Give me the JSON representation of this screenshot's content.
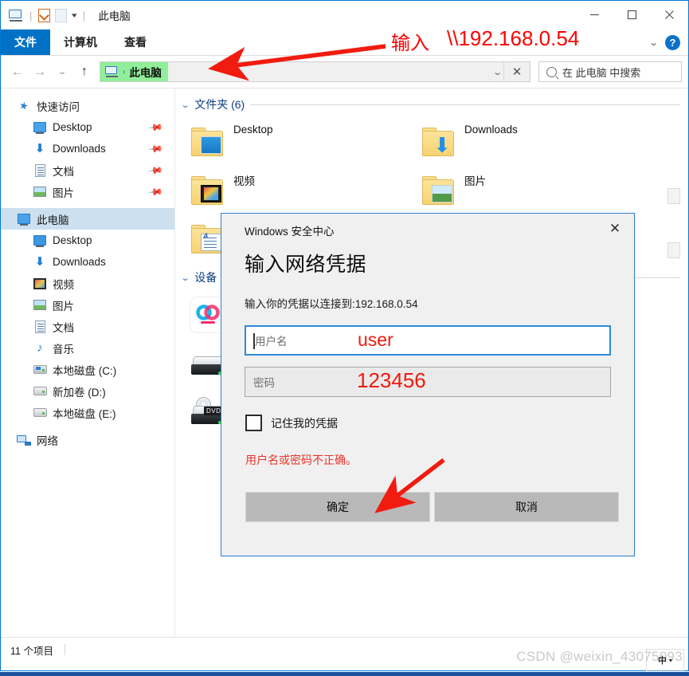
{
  "window": {
    "title": "此电脑",
    "quick_access_icons": [
      "this-pc-icon",
      "properties-icon",
      "new-folder-icon",
      "customize-caret-icon"
    ],
    "controls": {
      "minimize": "—",
      "maximize": "□",
      "close": "✕"
    }
  },
  "ribbon": {
    "tabs": [
      {
        "label": "文件",
        "active": true
      },
      {
        "label": "计算机",
        "active": false
      },
      {
        "label": "查看",
        "active": false
      }
    ],
    "collapse_caret": "⌄",
    "help_label": "?"
  },
  "addressbar": {
    "back": "←",
    "forward": "→",
    "recent": "⌄",
    "up": "↑",
    "breadcrumb_icon": "this-pc-icon",
    "breadcrumb_sep": "›",
    "breadcrumb_text": "此电脑",
    "dropdown_caret": "⌄",
    "clear_label": "✕",
    "search_placeholder": "在 此电脑 中搜索"
  },
  "sidebar": {
    "items": [
      {
        "label": "快速访问",
        "icon": "star-icon",
        "level": 0,
        "pinned": false,
        "selected": false
      },
      {
        "label": "Desktop",
        "icon": "monitor-icon",
        "level": 1,
        "pinned": true,
        "selected": false
      },
      {
        "label": "Downloads",
        "icon": "download-icon",
        "level": 1,
        "pinned": true,
        "selected": false
      },
      {
        "label": "文档",
        "icon": "documents-icon",
        "level": 1,
        "pinned": true,
        "selected": false
      },
      {
        "label": "图片",
        "icon": "pictures-icon",
        "level": 1,
        "pinned": true,
        "selected": false
      },
      {
        "label": "此电脑",
        "icon": "this-pc-icon",
        "level": 0,
        "pinned": false,
        "selected": true
      },
      {
        "label": "Desktop",
        "icon": "monitor-icon",
        "level": 1,
        "pinned": false,
        "selected": false
      },
      {
        "label": "Downloads",
        "icon": "download-icon",
        "level": 1,
        "pinned": false,
        "selected": false
      },
      {
        "label": "视频",
        "icon": "videos-icon",
        "level": 1,
        "pinned": false,
        "selected": false
      },
      {
        "label": "图片",
        "icon": "pictures-icon",
        "level": 1,
        "pinned": false,
        "selected": false
      },
      {
        "label": "文档",
        "icon": "documents-icon",
        "level": 1,
        "pinned": false,
        "selected": false
      },
      {
        "label": "音乐",
        "icon": "music-icon",
        "level": 1,
        "pinned": false,
        "selected": false
      },
      {
        "label": "本地磁盘 (C:)",
        "icon": "system-drive-icon",
        "level": 1,
        "pinned": false,
        "selected": false
      },
      {
        "label": "新加卷 (D:)",
        "icon": "drive-icon",
        "level": 1,
        "pinned": false,
        "selected": false
      },
      {
        "label": "本地磁盘 (E:)",
        "icon": "drive-icon",
        "level": 1,
        "pinned": false,
        "selected": false
      },
      {
        "label": "网络",
        "icon": "network-icon",
        "level": 0,
        "pinned": false,
        "selected": false
      }
    ]
  },
  "content": {
    "folders_group": {
      "chevron": "⌄",
      "title": "文件夹 (6)"
    },
    "folders": [
      {
        "label": "Desktop",
        "icon": "folder-desktop-icon"
      },
      {
        "label": "Downloads",
        "icon": "folder-downloads-icon"
      },
      {
        "label": "视频",
        "icon": "folder-videos-icon"
      },
      {
        "label": "图片",
        "icon": "folder-pictures-icon"
      },
      {
        "label": "文档",
        "icon": "folder-documents-icon"
      }
    ],
    "devices_group": {
      "chevron": "⌄",
      "title": "设备"
    },
    "devices": [
      {
        "label": "",
        "icon": "app-tile-icon"
      },
      {
        "label": "",
        "icon": "hard-drive-icon"
      },
      {
        "label": "",
        "icon": "dvd-drive-icon",
        "badge": "DVD"
      }
    ]
  },
  "statusbar": {
    "item_count": "11 个项目"
  },
  "dialog": {
    "titlebar": "Windows 安全中心",
    "close": "✕",
    "heading": "输入网络凭据",
    "subtitle": "输入你的凭据以连接到:192.168.0.54",
    "username": {
      "placeholder": "用户名",
      "value": "user"
    },
    "password": {
      "placeholder": "密码",
      "value": "123456"
    },
    "remember": {
      "label": "记住我的凭据",
      "checked": false
    },
    "error": "用户名或密码不正确。",
    "ok_label": "确定",
    "cancel_label": "取消"
  },
  "annotations": {
    "input_label": "输入",
    "ip_path": "\\\\192.168.0.54",
    "arrow_color": "#ff0000"
  },
  "watermark": {
    "text": "CSDN @weixin_43075093"
  },
  "ime": {
    "mode": "中",
    "caret": "▾"
  },
  "colors": {
    "accent": "#0078d7",
    "ribbon_active": "#0072c6",
    "breadcrumb_highlight": "#90ee9a",
    "selection": "#cce0f0",
    "annotation_red": "#ff0000",
    "error_red": "#e8352b",
    "dialog_bg": "#f0f0f0",
    "button_bg": "#b9b9b9"
  }
}
